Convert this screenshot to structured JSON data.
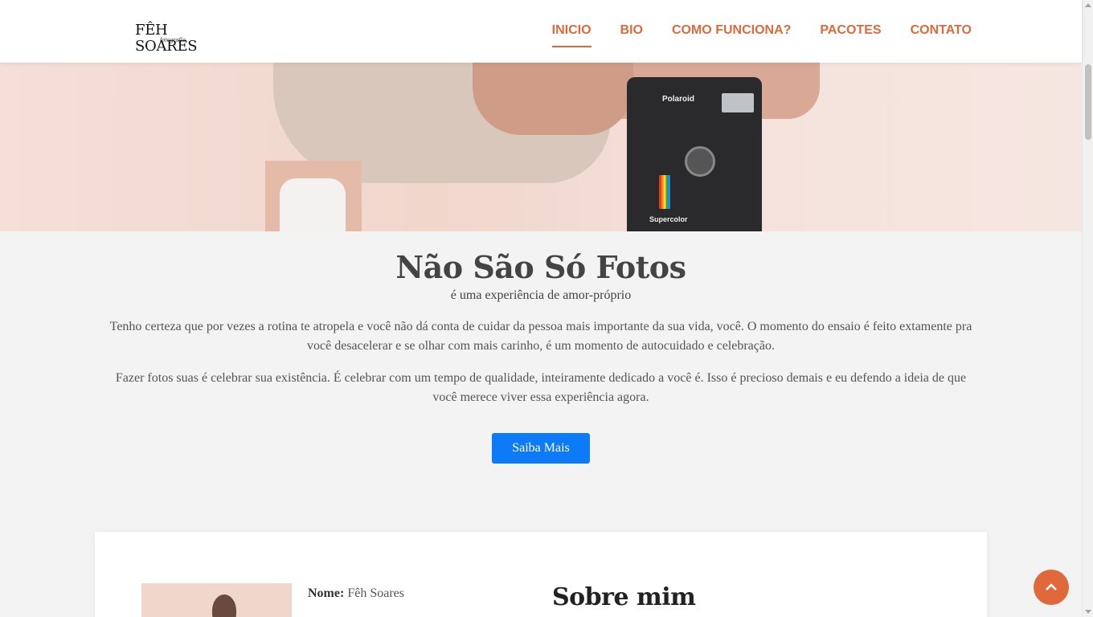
{
  "brand": {
    "name": "FÊH SOARES",
    "tagline": "fotografia"
  },
  "nav": {
    "items": [
      {
        "label": "INICIO",
        "active": true
      },
      {
        "label": "BIO"
      },
      {
        "label": "COMO FUNCIONA?"
      },
      {
        "label": "PACOTES"
      },
      {
        "label": "CONTATO"
      }
    ]
  },
  "hero": {
    "camera_brand": "Polaroid",
    "camera_model": "Supercolor"
  },
  "intro": {
    "title": "Não São Só Fotos",
    "subtitle": "é uma experiência de amor-próprio",
    "paragraphs": [
      "Tenho certeza que por vezes a rotina te atropela e você não dá conta de cuidar da pessoa mais importante da sua vida, você. O momento do ensaio é feito extamente pra você desacelerar e se olhar com mais carinho, é um momento de autocuidado e celebração.",
      "Fazer fotos suas é celebrar sua existência. É celebrar com um tempo de qualidade, inteiramente dedicado a você é. Isso é precioso demais e eu defendo a ideia de que você merece viver essa experiência agora."
    ],
    "button": "Saiba Mais"
  },
  "about": {
    "name_label": "Nome:",
    "name_value": "Fêh Soares",
    "heading": "Sobre mim"
  },
  "colors": {
    "accent": "#e0693c",
    "button": "#0d7bf7",
    "heading": "#444444"
  },
  "icons": {
    "back_to_top": "chevron-up-icon"
  }
}
